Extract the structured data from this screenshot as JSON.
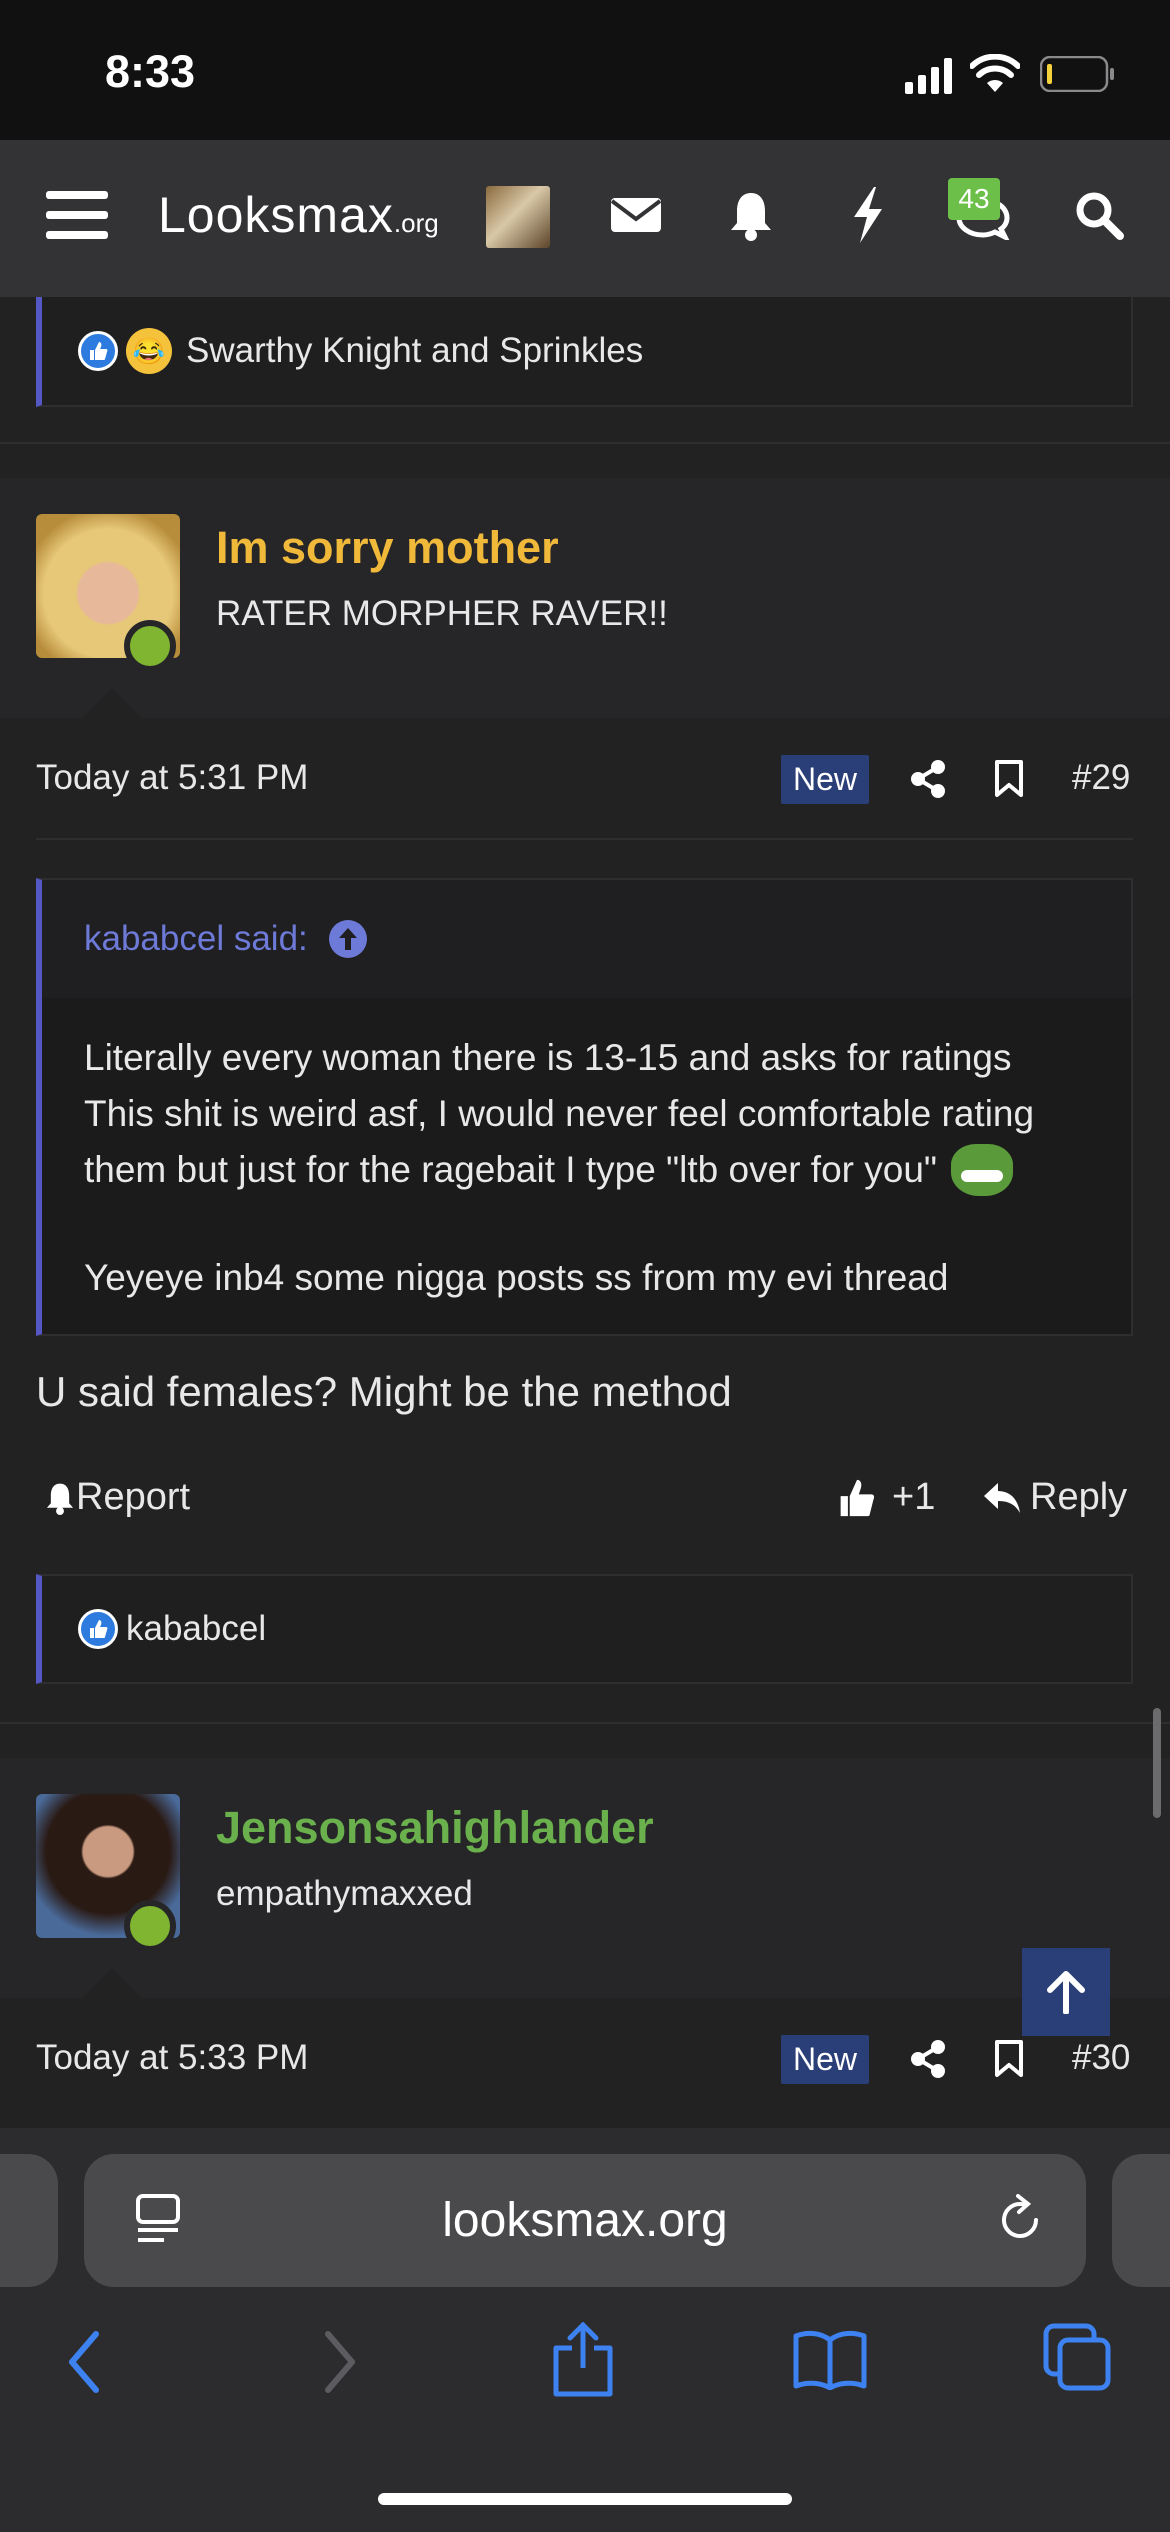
{
  "status_bar": {
    "time": "8:33"
  },
  "nav": {
    "logo_main": "Looksmax",
    "logo_suffix": ".org",
    "conversations_badge": "43",
    "icons": [
      "menu-icon",
      "avatar",
      "mail-icon",
      "bell-icon",
      "lightning-icon",
      "chat-icon",
      "search-icon"
    ]
  },
  "prev_reactions": {
    "text": "Swarthy Knight and Sprinkles"
  },
  "post29": {
    "username": "Im sorry mother",
    "user_title": "RATER MORPHER RAVER!!",
    "timestamp": "Today at 5:31 PM",
    "new_label": "New",
    "post_number": "#29",
    "quote_author": "kababcel said:",
    "quote_line1": "Literally every woman there is 13-15 and asks for ratings",
    "quote_line2": "This shit is weird asf, I would never feel comfortable rating",
    "quote_line3": "them but just for the ragebait I type \"ltb over for you\"",
    "quote_line4": "Yeyeye inb4 some nigga posts ss from my evi thread",
    "message": "U said females? Might be the method",
    "report_label": "Report",
    "like_label": "+1",
    "reply_label": "Reply",
    "reactions": "kababcel"
  },
  "post30": {
    "username": "Jensonsahighlander",
    "user_title": "empathymaxxed",
    "timestamp": "Today at 5:33 PM",
    "new_label": "New",
    "post_number": "#30"
  },
  "browser": {
    "url": "looksmax.org"
  },
  "colors": {
    "accent": "#5457c4",
    "username_gold": "#f0b93a",
    "username_green": "#6ab04c",
    "new_tag": "#2a3f78",
    "safari_blue": "#3d82f0"
  }
}
